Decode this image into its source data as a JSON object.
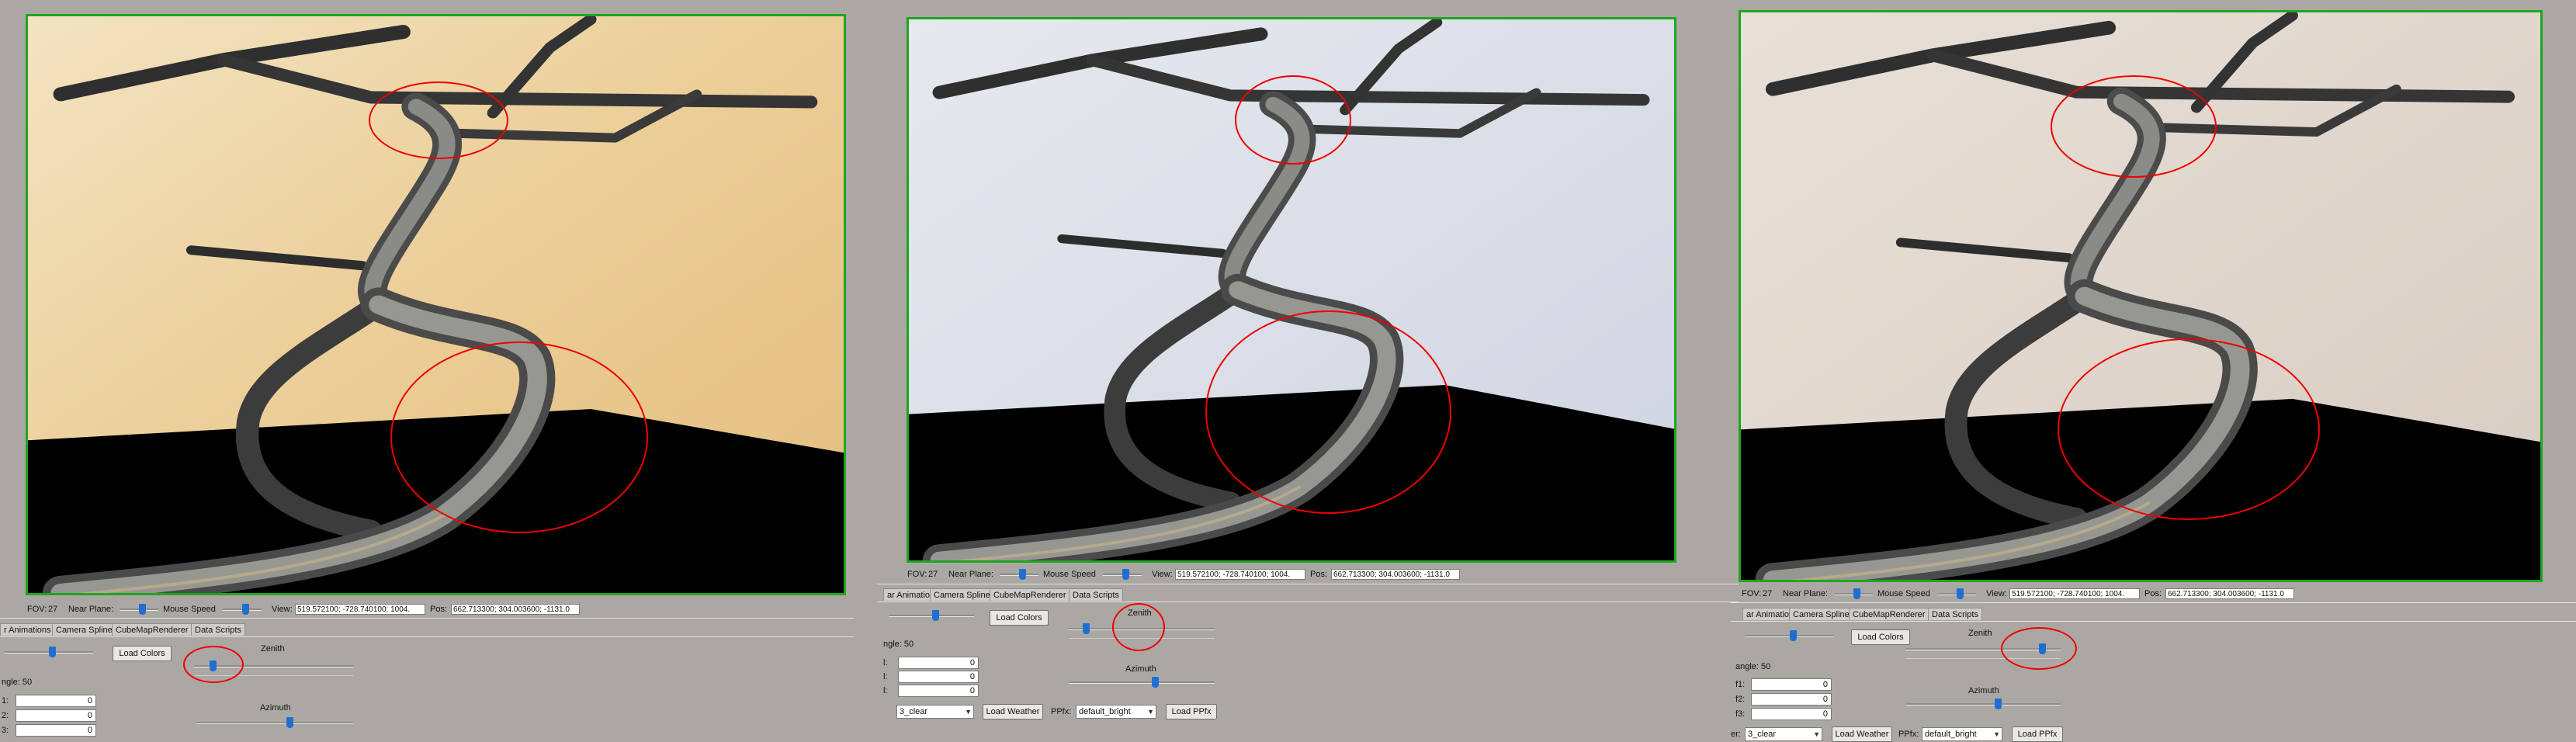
{
  "toolbar": {
    "fov_label": "FOV:",
    "fov_value": "27",
    "near_plane_label": "Near Plane:",
    "mouse_speed_label": "Mouse Speed",
    "view_label": "View:",
    "view_value": "519.572100; -728.740100; 1004.",
    "pos_label": "Pos:",
    "pos_value": "662.713300; 304.003600; -1131.0"
  },
  "tabs": [
    "ar Animations",
    "Camera Spline",
    "CubeMapRenderer",
    "Data Scripts"
  ],
  "tabs_left_panel": [
    "r Animations",
    "Camera Spline",
    "CubeMapRenderer",
    "Data Scripts"
  ],
  "controls": {
    "load_colors": "Load Colors",
    "zenith_label": "Zenith",
    "azimuth_label": "Azimuth",
    "angle_label_left": "ngle: 50",
    "angle_label_mid": "ngle: 50",
    "angle_label_right": "angle: 50",
    "f1_label": "f1:",
    "f2_label": "f2:",
    "f3_label": "f3:",
    "f1_left": "1:",
    "f2_left": "2:",
    "f3_left": "3:",
    "f_mid": "l:",
    "f_value": "0",
    "weather_prefix": "er:",
    "weather_value": "3_clear",
    "load_weather": "Load Weather",
    "ppfx_label": "PPfx:",
    "ppfx_value": "default_bright",
    "load_ppfx": "Load PPfx"
  },
  "levels": {
    "near_plane": 0.6,
    "mouse_speed": 0.6,
    "left_slider": 0.55,
    "zenith": 0.1,
    "azimuth": 0.6,
    "zenith_right": 0.9
  },
  "colors": {
    "viewport_border": "#1fa51f",
    "annotation": "#e00000",
    "slider_thumb": "#1f6fd1",
    "sky_warm": "#e9c98f",
    "sky_cool": "#d7dbe6",
    "sky_neutral": "#ddd3ca"
  }
}
